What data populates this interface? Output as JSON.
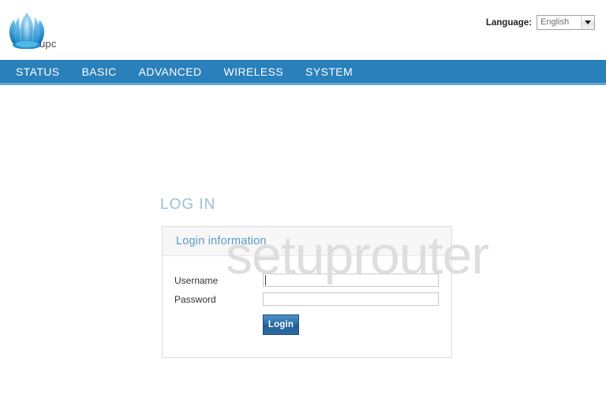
{
  "header": {
    "logo": {
      "icon": "lotus-flower-logo",
      "brand": "upc",
      "color": "#36a9e1"
    },
    "language": {
      "label": "Language:",
      "selected": "English",
      "options": [
        "English"
      ],
      "icon": "chevron-down-icon"
    }
  },
  "nav": {
    "items": [
      {
        "label": "STATUS"
      },
      {
        "label": "BASIC"
      },
      {
        "label": "ADVANCED"
      },
      {
        "label": "WIRELESS"
      },
      {
        "label": "SYSTEM"
      }
    ],
    "background": "#2980ba",
    "underline": "#5aa7d6"
  },
  "main": {
    "page_title": "LOG IN",
    "watermark": "setuprouter",
    "panel": {
      "title": "Login information",
      "fields": [
        {
          "label": "Username",
          "value": "",
          "placeholder": "",
          "type": "text",
          "focused": true
        },
        {
          "label": "Password",
          "value": "",
          "placeholder": "",
          "type": "password",
          "focused": false
        }
      ],
      "submit_label": "Login"
    }
  },
  "colors": {
    "accent_blue": "#2980ba",
    "title_blue": "#9bc0d8",
    "panel_title_blue": "#5a9bc4",
    "watermark_gray": "#dedede",
    "button_blue": "#1f5e97"
  }
}
